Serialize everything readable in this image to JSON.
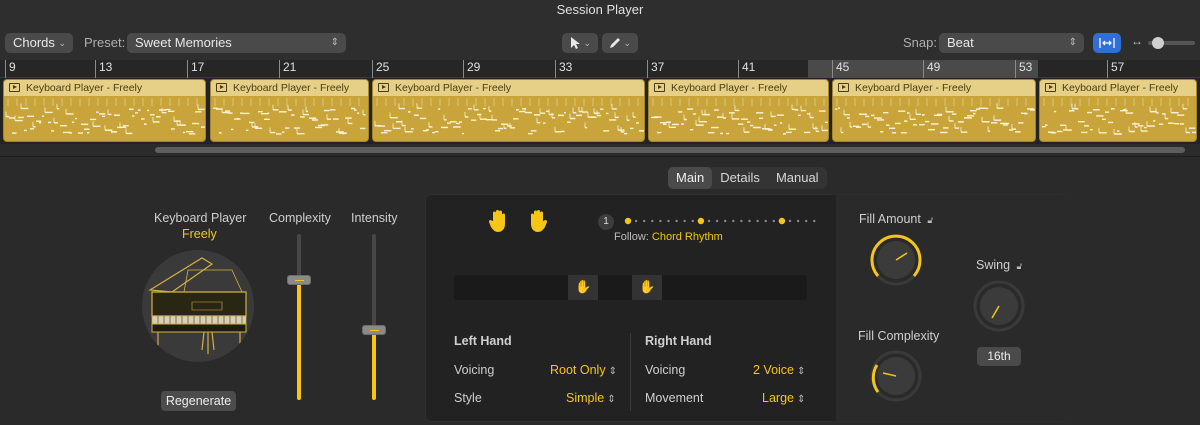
{
  "window": {
    "title": "Session Player"
  },
  "toolbar": {
    "track_type": "Chords",
    "preset_label": "Preset:",
    "preset_value": "Sweet Memories",
    "snap_label": "Snap:",
    "snap_value": "Beat"
  },
  "ruler": {
    "bars": [
      "9",
      "13",
      "17",
      "21",
      "25",
      "29",
      "33",
      "37",
      "41",
      "45",
      "49",
      "53",
      "57"
    ]
  },
  "regions": [
    {
      "name": "Keyboard Player - Freely"
    },
    {
      "name": "Keyboard Player - Freely"
    },
    {
      "name": "Keyboard Player - Freely"
    },
    {
      "name": "Keyboard Player - Freely"
    },
    {
      "name": "Keyboard Player - Freely"
    },
    {
      "name": "Keyboard Player - Freely"
    }
  ],
  "tabs": [
    "Main",
    "Details",
    "Manual"
  ],
  "player": {
    "name": "Keyboard Player",
    "style": "Freely",
    "regenerate": "Regenerate"
  },
  "sliders": {
    "complexity_label": "Complexity",
    "complexity_value": 0.72,
    "intensity_label": "Intensity",
    "intensity_value": 0.42
  },
  "follow": {
    "beat_number": "1",
    "label": "Follow:",
    "value": "Chord Rhythm"
  },
  "left_hand": {
    "title": "Left Hand",
    "voicing_label": "Voicing",
    "voicing_value": "Root Only",
    "style_label": "Style",
    "style_value": "Simple"
  },
  "right_hand": {
    "title": "Right Hand",
    "voicing_label": "Voicing",
    "voicing_value": "2 Voice",
    "movement_label": "Movement",
    "movement_value": "Large"
  },
  "fill": {
    "amount_label": "Fill Amount",
    "complexity_label": "Fill Complexity"
  },
  "swing": {
    "label": "Swing",
    "value": "16th"
  },
  "colors": {
    "accent": "#f5c518",
    "region": "#c9a43a",
    "region_header": "#e6cf86"
  },
  "icons": [
    "chevron-down-icon",
    "up-down-chevron-icon",
    "pointer-tool-icon",
    "pencil-tool-icon",
    "snap-to-grid-icon",
    "zoom-horizontal-icon",
    "left-hand-icon",
    "right-hand-icon",
    "lock-icon",
    "grand-piano-icon"
  ]
}
